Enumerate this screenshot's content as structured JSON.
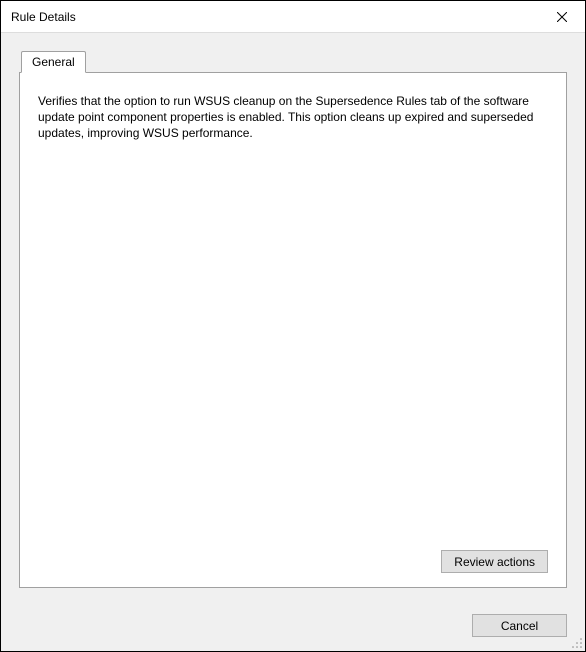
{
  "window": {
    "title": "Rule Details"
  },
  "tabs": {
    "general": {
      "label": "General"
    }
  },
  "content": {
    "description": "Verifies that the option to run WSUS cleanup on the Supersedence Rules tab of the software update point component properties is enabled. This option cleans up expired and superseded updates, improving WSUS performance."
  },
  "buttons": {
    "review_actions": "Review actions",
    "cancel": "Cancel"
  }
}
